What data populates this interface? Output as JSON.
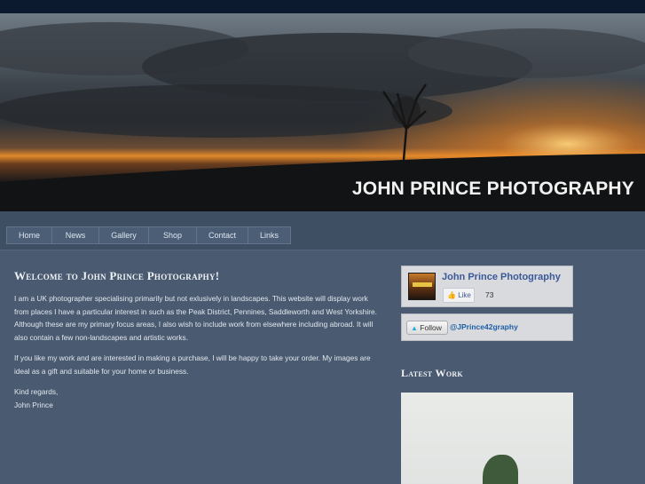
{
  "header": {
    "banner_title": "JOHN PRINCE PHOTOGRAPHY"
  },
  "nav": {
    "items": [
      {
        "label": "Home",
        "width": 52
      },
      {
        "label": "News",
        "width": 53
      },
      {
        "label": "Gallery",
        "width": 56
      },
      {
        "label": "Shop",
        "width": 54
      },
      {
        "label": "Contact",
        "width": 58
      },
      {
        "label": "Links",
        "width": 48
      }
    ]
  },
  "main": {
    "welcome_title": "Welcome to John Prince Photography!",
    "paragraph_1": "I am a UK photographer specialising primarily but not exlusively in landscapes. This website will display work from places I have a particular interest in such as the Peak District, Pennines, Saddleworth and West Yorkshire. Although these are my primary focus areas, I also wish to include work from elsewhere including abroad. It will also contain a few non-landscapes and artistic works.",
    "paragraph_2": "If you like my work and are interested in making a purchase, I will be happy to take your order. My images are ideal as a gift and suitable for your home or business.",
    "closing_1": "Kind regards,",
    "closing_2": "John Prince"
  },
  "sidebar": {
    "facebook": {
      "page_name": "John Prince Photography",
      "like_label": "Like",
      "like_count": "73",
      "icon": "thumbs-up-icon"
    },
    "twitter": {
      "follow_label": "Follow",
      "handle": "@JPrince42graphy",
      "icon": "twitter-bird-icon"
    },
    "latest_work_heading": "Latest Work"
  },
  "colors": {
    "page_bg": "#4a5a70",
    "top_bar": "#0b1a2e",
    "facebook_blue": "#3b5998"
  }
}
